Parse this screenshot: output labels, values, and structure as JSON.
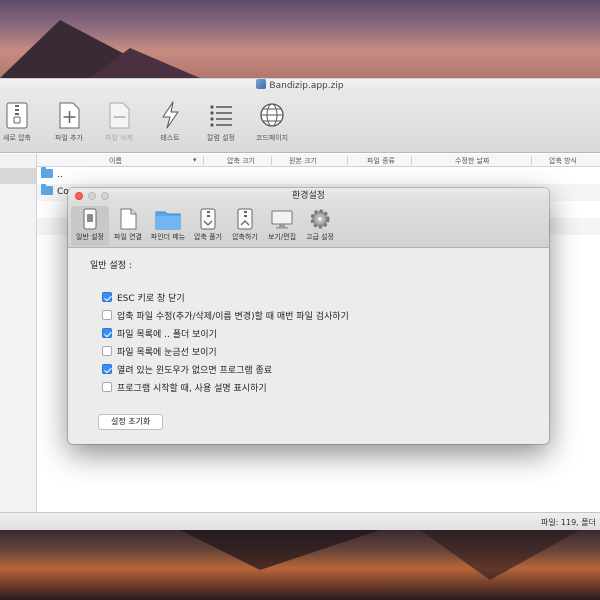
{
  "main_window": {
    "title": "Bandizip.app.zip",
    "toolbar": [
      {
        "label": "새로 압축",
        "icon": "new-archive-icon",
        "disabled": false
      },
      {
        "label": "파일 추가",
        "icon": "add-file-icon",
        "disabled": false
      },
      {
        "label": "파일 삭제",
        "icon": "delete-file-icon",
        "disabled": true
      },
      {
        "label": "테스트",
        "icon": "test-icon",
        "disabled": false
      },
      {
        "label": "칼럼 설정",
        "icon": "column-settings-icon",
        "disabled": false
      },
      {
        "label": "코드페이지",
        "icon": "codepage-icon",
        "disabled": false
      }
    ],
    "columns": [
      "이름",
      "압축 크기",
      "원본 크기",
      "파일 종류",
      "수정한 날짜",
      "압축 방식"
    ],
    "rows": [
      {
        "name": ".."
      },
      {
        "name": "Co"
      }
    ],
    "status": "파일: 119, 폴더"
  },
  "dialog": {
    "title": "환경설정",
    "tabs": [
      {
        "label": "일반 설정",
        "icon": "general-settings-icon",
        "active": true
      },
      {
        "label": "파일 연결",
        "icon": "file-association-icon",
        "active": false
      },
      {
        "label": "파인더 메뉴",
        "icon": "finder-menu-icon",
        "active": false
      },
      {
        "label": "압축 풀기",
        "icon": "extract-icon",
        "active": false
      },
      {
        "label": "압축하기",
        "icon": "compress-icon",
        "active": false
      },
      {
        "label": "보기/편집",
        "icon": "view-edit-icon",
        "active": false
      },
      {
        "label": "고급 설정",
        "icon": "advanced-settings-icon",
        "active": false
      }
    ],
    "section_title": "일반 설정 :",
    "options": [
      {
        "label": "ESC 키로 창 닫기",
        "checked": true
      },
      {
        "label": "압축 파일 수정(추가/삭제/이름 변경)할 때 매번 파일 검사하기",
        "checked": false
      },
      {
        "label": "파일 목록에 .. 폴더 보이기",
        "checked": true
      },
      {
        "label": "파일 목록에 눈금선 보이기",
        "checked": false
      },
      {
        "label": "열려 있는 윈도우가 없으면 프로그램 종료",
        "checked": true
      },
      {
        "label": "프로그램 시작할 때, 사용 설명 표시하기",
        "checked": false
      }
    ],
    "reset_label": "설정 초기화"
  },
  "colors": {
    "checkbox_on": "#3b8ff4",
    "close_button": "#fc5f57",
    "folder": "#5aa6e6"
  }
}
